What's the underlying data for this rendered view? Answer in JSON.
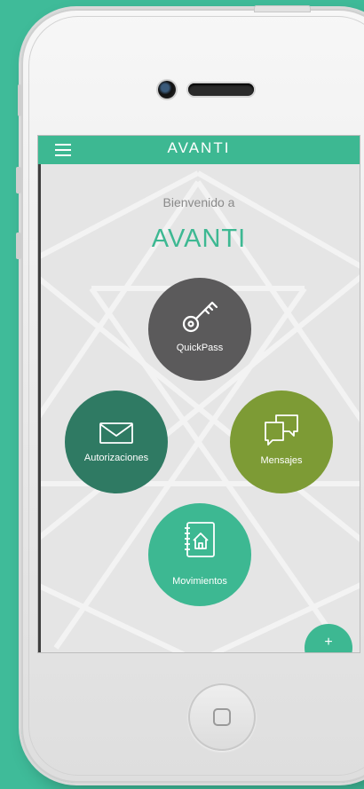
{
  "app": {
    "brand": "AVANTI",
    "menu_icon": "hamburger-menu-icon"
  },
  "welcome": {
    "greeting": "Bienvenido a",
    "title": "AVANTI"
  },
  "actions": [
    {
      "label": "QuickPass",
      "icon": "key-icon",
      "color": "#5b5a5b"
    },
    {
      "label": "Autorizaciones",
      "icon": "envelope-icon",
      "color": "#2f7a63"
    },
    {
      "label": "Mensajes",
      "icon": "chat-bubbles-icon",
      "color": "#7d9b35"
    },
    {
      "label": "Movimientos",
      "icon": "notebook-house-icon",
      "color": "#3db892"
    }
  ],
  "fab": {
    "label": "+",
    "icon": "plus-icon"
  },
  "colors": {
    "accent": "#3db892",
    "background": "#3fbb99",
    "screen": "#e5e5e5"
  }
}
